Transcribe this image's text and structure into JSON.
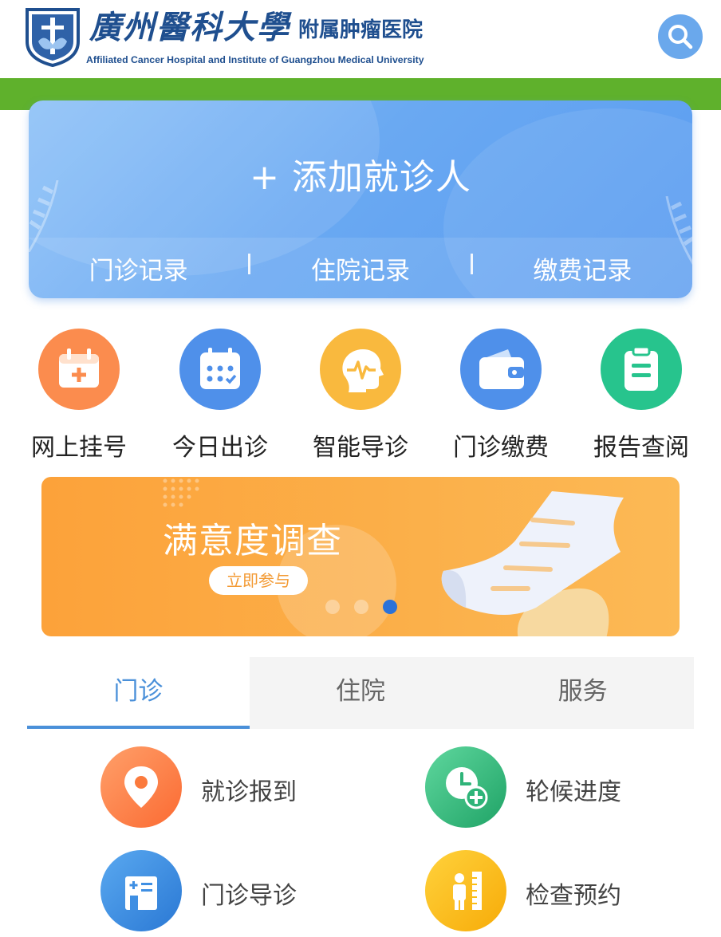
{
  "header": {
    "title_main": "廣州醫科大學",
    "title_sub": "附属肿瘤医院",
    "title_en": "Affiliated Cancer Hospital and Institute of Guangzhou Medical University"
  },
  "patient_card": {
    "add_label": "+ 添加就诊人",
    "links": [
      "门诊记录",
      "住院记录",
      "缴费记录"
    ]
  },
  "quick_actions": [
    {
      "label": "网上挂号",
      "icon": "calendar-plus-icon",
      "color": "#fb8c4e"
    },
    {
      "label": "今日出诊",
      "icon": "calendar-grid-icon",
      "color": "#4f90ea"
    },
    {
      "label": "智能导诊",
      "icon": "brain-pulse-icon",
      "color": "#f9b93e"
    },
    {
      "label": "门诊缴费",
      "icon": "wallet-icon",
      "color": "#4f90ea"
    },
    {
      "label": "报告查阅",
      "icon": "clipboard-icon",
      "color": "#27c48d"
    }
  ],
  "banner": {
    "title": "满意度调查",
    "button": "立即参与",
    "active_slide": 3,
    "slide_count": 3
  },
  "tabs": [
    "门诊",
    "住院",
    "服务"
  ],
  "active_tab": 0,
  "services": [
    {
      "label": "就诊报到",
      "icon": "location-pin-icon",
      "color": "#fb7a3d"
    },
    {
      "label": "轮候进度",
      "icon": "clock-plus-icon",
      "color": "#2fb479"
    },
    {
      "label": "门诊导诊",
      "icon": "building-icon",
      "color": "#3f8fe3"
    },
    {
      "label": "检查预约",
      "icon": "person-ruler-icon",
      "color": "#fbbd14"
    }
  ],
  "colors": {
    "brand_blue": "#1f4f8f",
    "green_bar": "#5fb12c",
    "card_blue": "#6aa9f2",
    "tab_active": "#4a90d9"
  }
}
